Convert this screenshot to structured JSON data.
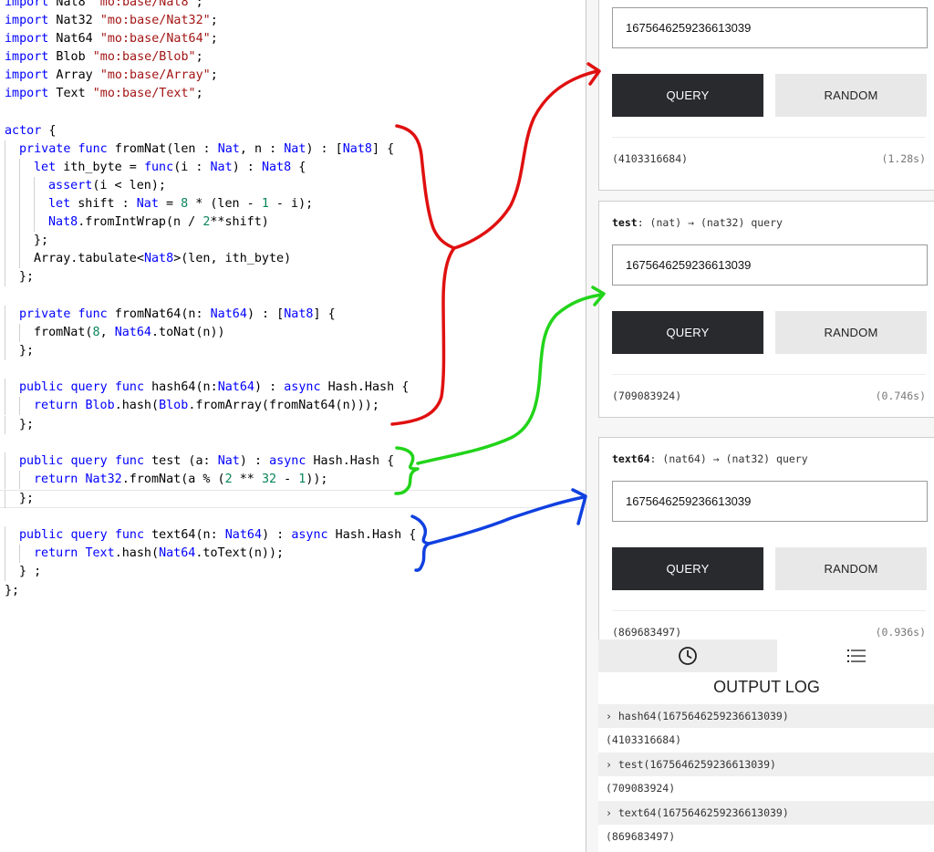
{
  "editor": {
    "lines": [
      {
        "t": "import Nat8 \"mo:base/Nat8\";"
      },
      {
        "t": "import Nat32 \"mo:base/Nat32\";"
      },
      {
        "t": "import Nat64 \"mo:base/Nat64\";"
      },
      {
        "t": "import Blob \"mo:base/Blob\";"
      },
      {
        "t": "import Array \"mo:base/Array\";"
      },
      {
        "t": "import Text \"mo:base/Text\";"
      },
      {
        "t": ""
      },
      {
        "t": "actor {"
      },
      {
        "t": "private func fromNat(len : Nat, n : Nat) : [Nat8] {"
      },
      {
        "t": "let ith_byte = func(i : Nat) : Nat8 {"
      },
      {
        "t": "assert(i < len);"
      },
      {
        "t": "let shift : Nat = 8 * (len - 1 - i);"
      },
      {
        "t": "Nat8.fromIntWrap(n / 2**shift)"
      },
      {
        "t": "};"
      },
      {
        "t": "Array.tabulate<Nat8>(len, ith_byte)"
      },
      {
        "t": "};"
      },
      {
        "t": ""
      },
      {
        "t": "private func fromNat64(n: Nat64) : [Nat8] {"
      },
      {
        "t": "fromNat(8, Nat64.toNat(n))"
      },
      {
        "t": "};"
      },
      {
        "t": ""
      },
      {
        "t": "public query func hash64(n:Nat64) : async Hash.Hash {"
      },
      {
        "t": "return Blob.hash(Blob.fromArray(fromNat64(n)));"
      },
      {
        "t": "};"
      },
      {
        "t": ""
      },
      {
        "t": "public query func test (a: Nat) : async Hash.Hash {"
      },
      {
        "t": "return Nat32.fromNat(a % (2 ** 32 - 1));"
      },
      {
        "t": "};"
      },
      {
        "t": ""
      },
      {
        "t": "public query func text64(n: Nat64) : async Hash.Hash {"
      },
      {
        "t": "return Text.hash(Nat64.toText(n));"
      },
      {
        "t": "} ;"
      },
      {
        "t": "};"
      }
    ]
  },
  "cards": [
    {
      "method": "",
      "signature": "",
      "input_value": "1675646259236613039",
      "query_label": "QUERY",
      "random_label": "RANDOM",
      "result": "(4103316684)",
      "time": "(1.28s)"
    },
    {
      "method": "test",
      "signature": ": (nat) → (nat32) query",
      "input_value": "1675646259236613039",
      "query_label": "QUERY",
      "random_label": "RANDOM",
      "result": "(709083924)",
      "time": "(0.746s)"
    },
    {
      "method": "text64",
      "signature": ": (nat64) → (nat32) query",
      "input_value": "1675646259236613039",
      "query_label": "QUERY",
      "random_label": "RANDOM",
      "result": "(869683497)",
      "time": "(0.936s)"
    }
  ],
  "log": {
    "title": "OUTPUT LOG",
    "tabs": [
      {
        "icon": "clock-icon"
      },
      {
        "icon": "list-icon"
      }
    ],
    "entries": [
      {
        "call": "› hash64(1675646259236613039)",
        "result": "(4103316684)"
      },
      {
        "call": "› test(1675646259236613039)",
        "result": "(709083924)"
      },
      {
        "call": "› text64(1675646259236613039)",
        "result": "(869683497)"
      }
    ]
  },
  "colors": {
    "keyword": "#0000ff",
    "string": "#a31515",
    "number": "#098658",
    "query_button": "#292a2e",
    "random_button": "#e8e8e8",
    "annotation_red": "#e01010",
    "annotation_green": "#22d41a",
    "annotation_blue": "#1040e0"
  }
}
